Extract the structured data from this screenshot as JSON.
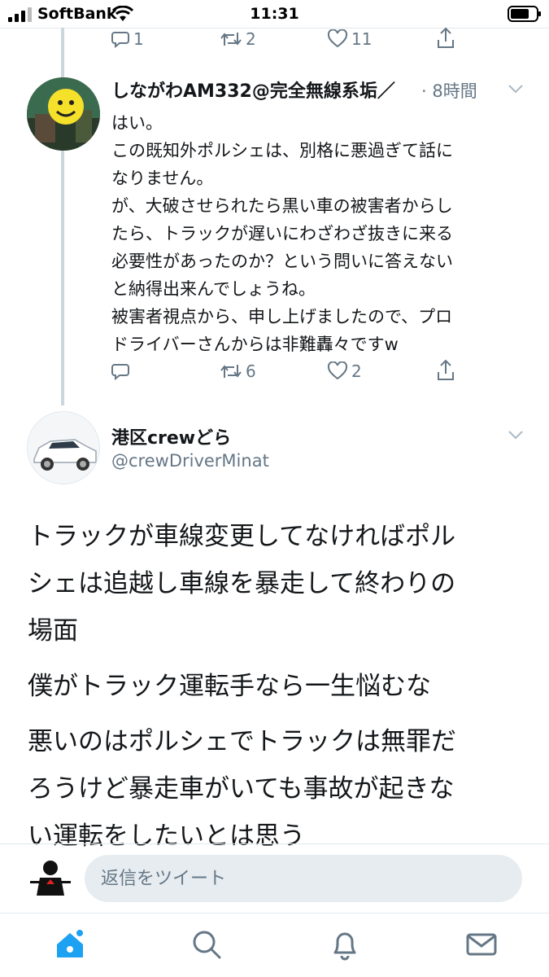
{
  "status_bar": {
    "carrier": "SoftBank",
    "time": "11:31",
    "icons": [
      "cellular-signal-icon",
      "wifi-icon",
      "battery-icon"
    ]
  },
  "top_actions": {
    "reply_count": "1",
    "retweet_count": "2",
    "like_count": "11"
  },
  "tweet1": {
    "name": "しながわAM332@完全無線系垢／",
    "time": "· 8時間",
    "body_lines": [
      "はい。",
      "この既知外ポルシェは、別格に悪過ぎて話に",
      "なりません。",
      "が、大破させられたら黒い車の被害者からし",
      "たら、トラックが遅いにわざわざ抜きに来る",
      "必要性があったのか？という問いに答えない",
      "と納得出来んでしょうね。",
      "被害者視点から、申し上げましたので、プロ",
      "ドライバーさんからは非難轟々ですw"
    ],
    "actions": {
      "reply_count": "",
      "retweet_count": "6",
      "like_count": "2"
    }
  },
  "tweet2": {
    "name": "港区crewどら",
    "handle": "@crewDriverMinat",
    "paragraphs": [
      [
        "トラックが車線変更してなければポル",
        "シェは追越し車線を暴走して終わりの",
        "場面"
      ],
      [
        "僕がトラック運転手なら一生悩むな"
      ],
      [
        "悪いのはポルシェでトラックは無罪だ",
        "ろうけど暴走車がいても事故が起きな",
        "い運転をしたいとは思う"
      ]
    ]
  },
  "reply": {
    "placeholder": "返信をツイート"
  },
  "tab_bar": {
    "tabs": [
      "home-icon",
      "search-icon",
      "notifications-icon",
      "messages-icon"
    ]
  },
  "colors": {
    "accent": "#1da1f2",
    "muted": "#657786",
    "text": "#14171a",
    "thread_line": "#ccd6dd"
  }
}
